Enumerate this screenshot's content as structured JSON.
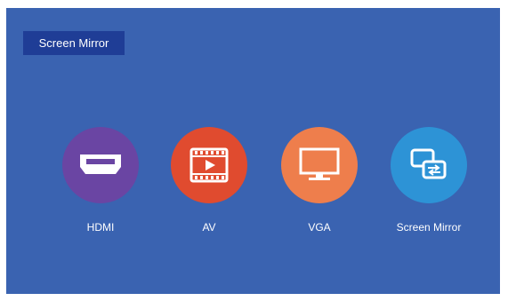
{
  "header": {
    "title": "Screen Mirror"
  },
  "sources": [
    {
      "label": "HDMI",
      "icon": "hdmi-icon",
      "color": "#6a45a3"
    },
    {
      "label": "AV",
      "icon": "film-play-icon",
      "color": "#e04b2f"
    },
    {
      "label": "VGA",
      "icon": "monitor-icon",
      "color": "#ee7e4c"
    },
    {
      "label": "Screen Mirror",
      "icon": "screen-mirror-icon",
      "color": "#2d93d6"
    }
  ],
  "colors": {
    "background": "#3a63b1",
    "title_badge": "#1f3d96",
    "text": "#ffffff"
  }
}
